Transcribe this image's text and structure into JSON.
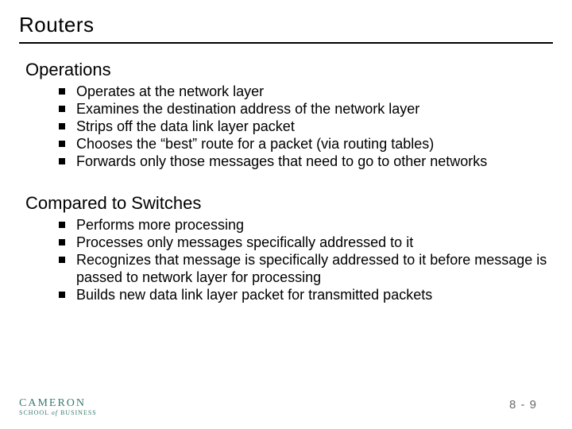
{
  "title": "Routers",
  "sections": [
    {
      "heading": "Operations",
      "items": [
        "Operates at the network layer",
        "Examines the destination address of the network layer",
        "Strips off the data link layer packet",
        "Chooses the “best” route for a packet (via routing tables)",
        "Forwards only those messages that need to go to other networks"
      ]
    },
    {
      "heading": "Compared to Switches",
      "items": [
        "Performs more processing",
        "Processes only messages specifically addressed to it",
        "Recognizes that message is specifically addressed to it before message is passed to network layer for processing",
        "Builds new data link layer packet for transmitted packets"
      ]
    }
  ],
  "logo": {
    "top": "CAMERON",
    "bottom_prefix": "SCHOOL ",
    "bottom_em": "of",
    "bottom_suffix": " BUSINESS"
  },
  "page_number": "8 - 9",
  "colors": {
    "logo": "#3a7a6f",
    "pagenum": "#6b6b6b"
  }
}
